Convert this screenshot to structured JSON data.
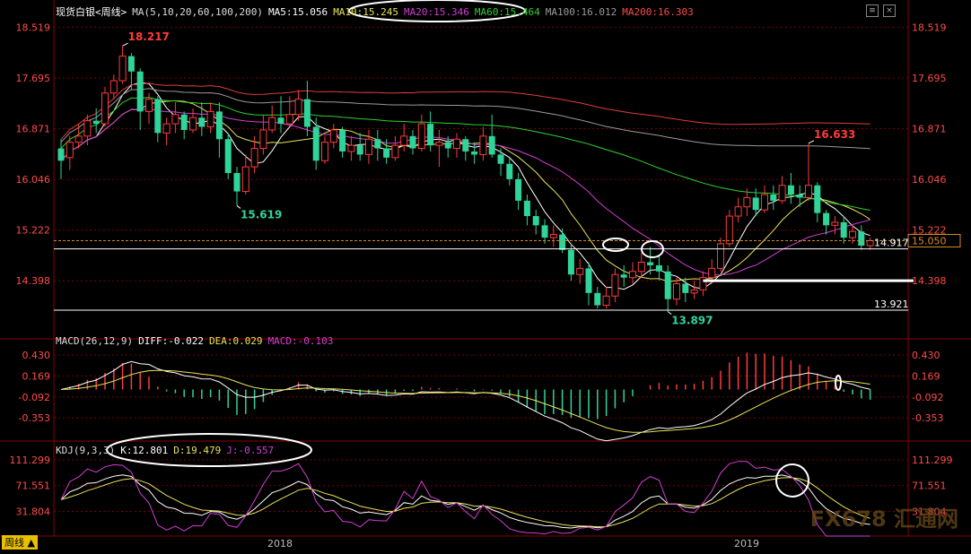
{
  "header": {
    "title": "现货白银<周线>",
    "ma_title": "MA(5,10,20,60,100,200)",
    "ma5": "MA5:15.056",
    "ma10": "MA10:15.245",
    "ma20": "MA20:15.346",
    "ma60": "MA60:15.464",
    "ma100": "MA100:16.012",
    "ma200": "MA200:16.303"
  },
  "macd_header": {
    "title": "MACD(26,12,9)",
    "diff": "DIFF:-0.022",
    "dea": "DEA:0.029",
    "macd": "MACD:-0.103"
  },
  "kdj_header": {
    "title": "KDJ(9,3,3)",
    "k": "K:12.801",
    "d": "D:19.479",
    "j": "J:-0.557"
  },
  "footer": {
    "period_label": "周线",
    "years": [
      "2018",
      "2019"
    ]
  },
  "watermark": "FX678 汇通网",
  "colors": {
    "up": "#ff3b3b",
    "down": "#2fd49a",
    "ma5": "#ffffff",
    "ma10": "#e8e35a",
    "ma20": "#d23fd2",
    "ma60": "#2fd12f",
    "ma100": "#9a9a9a",
    "ma200": "#e03b3b",
    "grid": "#7a0000"
  },
  "chart_data": [
    {
      "type": "candlestick",
      "name": "main",
      "yticks": [
        18.519,
        17.695,
        16.871,
        16.046,
        15.222,
        14.398
      ],
      "ylim": [
        13.6,
        18.7
      ],
      "annotations": [
        {
          "text": "18.217",
          "value": 18.217
        },
        {
          "text": "15.619",
          "value": 15.619
        },
        {
          "text": "16.633",
          "value": 16.633
        },
        {
          "text": "13.897",
          "value": 13.897
        }
      ],
      "price_lines": [
        {
          "text": "14.917",
          "value": 14.917
        },
        {
          "text": "13.921",
          "value": 13.921
        }
      ],
      "current_price": {
        "text": "15.050",
        "value": 15.05
      },
      "candles": [
        [
          16.55,
          16.35,
          16.7,
          16.05
        ],
        [
          16.4,
          16.65,
          16.75,
          16.2
        ],
        [
          16.65,
          16.75,
          16.95,
          16.55
        ],
        [
          16.75,
          17.0,
          17.1,
          16.6
        ],
        [
          17.0,
          16.95,
          17.2,
          16.8
        ],
        [
          16.95,
          17.45,
          17.55,
          16.9
        ],
        [
          17.45,
          17.65,
          17.75,
          17.35
        ],
        [
          17.65,
          18.05,
          18.217,
          17.6
        ],
        [
          18.05,
          17.8,
          18.1,
          17.5
        ],
        [
          17.8,
          17.15,
          17.85,
          16.85
        ],
        [
          17.15,
          17.35,
          17.45,
          16.95
        ],
        [
          17.35,
          16.8,
          17.4,
          16.65
        ],
        [
          16.8,
          16.95,
          17.05,
          16.6
        ],
        [
          16.95,
          17.1,
          17.3,
          16.8
        ],
        [
          17.1,
          16.85,
          17.15,
          16.7
        ],
        [
          16.85,
          17.05,
          17.2,
          16.8
        ],
        [
          17.05,
          16.9,
          17.3,
          16.75
        ],
        [
          16.9,
          17.15,
          17.3,
          16.8
        ],
        [
          17.15,
          16.7,
          17.3,
          16.4
        ],
        [
          16.7,
          16.15,
          16.8,
          16.05
        ],
        [
          16.15,
          15.85,
          16.25,
          15.619
        ],
        [
          15.85,
          16.25,
          16.45,
          15.8
        ],
        [
          16.25,
          16.55,
          16.75,
          16.15
        ],
        [
          16.55,
          16.85,
          17.1,
          16.45
        ],
        [
          16.85,
          17.05,
          17.25,
          16.8
        ],
        [
          17.05,
          16.95,
          17.4,
          16.8
        ],
        [
          16.95,
          17.1,
          17.4,
          16.9
        ],
        [
          17.1,
          17.35,
          17.5,
          17.0
        ],
        [
          17.35,
          16.9,
          17.65,
          16.75
        ],
        [
          16.9,
          16.35,
          17.05,
          16.2
        ],
        [
          16.35,
          16.65,
          16.75,
          16.3
        ],
        [
          16.65,
          16.85,
          16.95,
          16.55
        ],
        [
          16.85,
          16.5,
          16.9,
          16.4
        ],
        [
          16.5,
          16.6,
          16.75,
          16.35
        ],
        [
          16.6,
          16.45,
          16.8,
          16.35
        ],
        [
          16.45,
          16.7,
          16.85,
          16.3
        ],
        [
          16.7,
          16.55,
          16.85,
          16.35
        ],
        [
          16.55,
          16.4,
          16.7,
          16.3
        ],
        [
          16.4,
          16.6,
          16.75,
          16.35
        ],
        [
          16.6,
          16.75,
          16.95,
          16.5
        ],
        [
          16.75,
          16.55,
          16.85,
          16.45
        ],
        [
          16.55,
          16.95,
          17.1,
          16.5
        ],
        [
          16.95,
          16.6,
          17.15,
          16.5
        ],
        [
          16.6,
          16.65,
          16.85,
          16.25
        ],
        [
          16.65,
          16.55,
          16.75,
          16.4
        ],
        [
          16.55,
          16.7,
          16.8,
          16.4
        ],
        [
          16.7,
          16.5,
          16.75,
          16.35
        ],
        [
          16.5,
          16.45,
          16.65,
          16.3
        ],
        [
          16.45,
          16.75,
          16.9,
          16.35
        ],
        [
          16.75,
          16.45,
          17.1,
          16.4
        ],
        [
          16.45,
          16.3,
          16.55,
          16.1
        ],
        [
          16.3,
          16.05,
          16.4,
          15.95
        ],
        [
          16.05,
          15.7,
          16.15,
          15.55
        ],
        [
          15.7,
          15.45,
          15.8,
          15.3
        ],
        [
          15.45,
          15.3,
          15.55,
          15.15
        ],
        [
          15.3,
          15.1,
          15.4,
          15.0
        ],
        [
          15.1,
          15.15,
          15.3,
          14.95
        ],
        [
          15.15,
          14.9,
          15.25,
          14.85
        ],
        [
          14.9,
          14.5,
          15.0,
          14.4
        ],
        [
          14.5,
          14.6,
          14.75,
          14.35
        ],
        [
          14.6,
          14.2,
          14.7,
          14.0
        ],
        [
          14.2,
          14.0,
          14.3,
          13.95
        ],
        [
          14.0,
          14.15,
          14.3,
          13.95
        ],
        [
          14.15,
          14.5,
          14.6,
          14.05
        ],
        [
          14.5,
          14.45,
          14.65,
          14.3
        ],
        [
          14.45,
          14.55,
          14.7,
          14.35
        ],
        [
          14.55,
          14.7,
          14.85,
          14.45
        ],
        [
          14.7,
          14.65,
          14.95,
          14.5
        ],
        [
          14.65,
          14.55,
          14.8,
          14.4
        ],
        [
          14.55,
          14.1,
          14.65,
          13.897
        ],
        [
          14.1,
          14.35,
          14.45,
          14.0
        ],
        [
          14.35,
          14.2,
          14.45,
          14.05
        ],
        [
          14.2,
          14.25,
          14.4,
          14.1
        ],
        [
          14.25,
          14.45,
          14.55,
          14.15
        ],
        [
          14.45,
          14.6,
          14.75,
          14.35
        ],
        [
          14.6,
          15.0,
          15.1,
          14.55
        ],
        [
          15.0,
          15.45,
          15.55,
          14.95
        ],
        [
          15.45,
          15.6,
          15.75,
          15.35
        ],
        [
          15.6,
          15.75,
          15.9,
          15.45
        ],
        [
          15.75,
          15.55,
          15.9,
          15.45
        ],
        [
          15.55,
          15.8,
          15.95,
          15.5
        ],
        [
          15.8,
          15.7,
          15.95,
          15.55
        ],
        [
          15.7,
          15.95,
          16.1,
          15.65
        ],
        [
          15.95,
          15.8,
          16.15,
          15.65
        ],
        [
          15.8,
          15.75,
          15.95,
          15.6
        ],
        [
          15.75,
          15.95,
          16.633,
          15.7
        ],
        [
          15.95,
          15.5,
          16.0,
          15.35
        ],
        [
          15.5,
          15.3,
          15.55,
          15.15
        ],
        [
          15.3,
          15.35,
          15.45,
          15.15
        ],
        [
          15.35,
          15.1,
          15.45,
          15.0
        ],
        [
          15.1,
          15.2,
          15.3,
          15.0
        ],
        [
          15.2,
          14.97,
          15.3,
          14.9
        ],
        [
          14.97,
          15.05,
          15.1,
          14.9
        ]
      ]
    },
    {
      "type": "line",
      "name": "macd",
      "yticks": [
        0.43,
        0.169,
        -0.092,
        -0.353
      ],
      "ylim": [
        -0.62,
        0.52
      ]
    },
    {
      "type": "line",
      "name": "kdj",
      "yticks": [
        111.299,
        71.551,
        31.804
      ],
      "ylim": [
        -6,
        118
      ]
    }
  ]
}
